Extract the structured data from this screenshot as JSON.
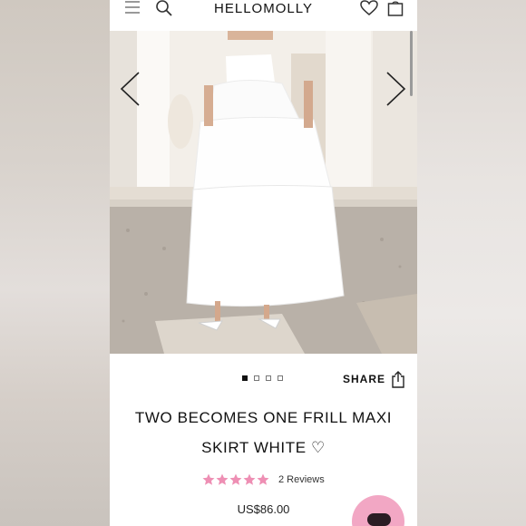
{
  "header": {
    "logo": "HELLOMOLLY",
    "icons": [
      "menu-icon",
      "search-icon",
      "heart-icon",
      "bag-icon"
    ]
  },
  "gallery": {
    "slide_count": 4,
    "active_slide": 1,
    "icons": [
      "chevron-left-icon",
      "chevron-right-icon"
    ]
  },
  "share": {
    "label": "SHARE"
  },
  "product": {
    "title_line1": "TWO BECOMES ONE FRILL MAXI",
    "title_line2": "SKIRT WHITE",
    "wishlist_glyph": "♡",
    "rating": 5,
    "reviews": "2 Reviews",
    "price": "US$86.00"
  },
  "colors": {
    "star": "#ee8fb4",
    "chat_button": "#f2a7c4"
  }
}
